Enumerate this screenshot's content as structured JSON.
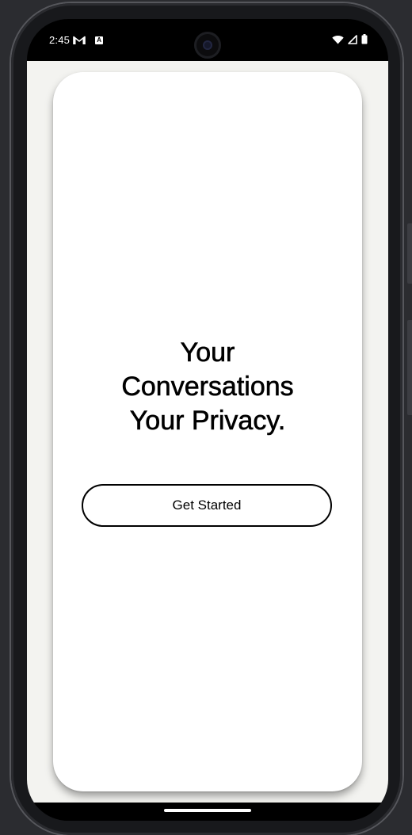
{
  "status_bar": {
    "time": "2:45",
    "notification_icons": [
      "gmail-icon",
      "a-badge-icon"
    ],
    "a_badge_label": "A",
    "system_icons": [
      "wifi-icon",
      "cellular-signal-icon",
      "battery-icon"
    ]
  },
  "onboarding": {
    "headline_lines": [
      "Your",
      "Conversations",
      "Your Privacy."
    ],
    "cta_label": "Get Started"
  },
  "colors": {
    "background": "#f3f3f0",
    "card": "#ffffff",
    "text": "#000000",
    "button_border": "#000000"
  }
}
